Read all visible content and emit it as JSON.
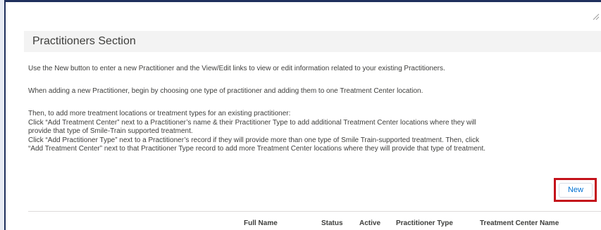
{
  "section": {
    "title": "Practitioners Section"
  },
  "instructions": {
    "p1": "Use the New button to enter a new Practitioner and the View/Edit links to view or edit information related to your existing Practitioners.",
    "p2": "When adding a new Practitioner, begin by choosing one type of practitioner and adding them to one Treatment Center location.",
    "p3": "Then, to add more treatment locations or treatment types for an existing practitioner:",
    "p4": "Click “Add Treatment Center” next to a Practitioner’s name & their Practitioner Type to add additional Treatment Center locations where they will",
    "p5": "provide that type of Smile-Train supported treatment.",
    "p6": "Click “Add Practitioner Type” next to a Practitioner’s record if they will provide more than one type of Smile Train-supported treatment. Then, click",
    "p7": "“Add Treatment Center” next to that Practitioner Type record to add more Treatment Center locations where they will provide that type of treatment."
  },
  "actions": {
    "new_label": "New"
  },
  "table": {
    "columns": [
      "Full Name",
      "Status",
      "Active",
      "Practitioner Type",
      "Treatment Center Name"
    ]
  }
}
